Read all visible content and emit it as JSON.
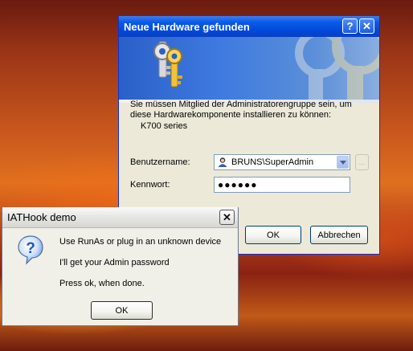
{
  "hardware_dialog": {
    "title": "Neue Hardware gefunden",
    "help_button": "?",
    "close_button": "✕",
    "message": "Sie müssen Mitglied der Administratorengruppe sein, um diese Hardwarekomponente installieren zu können:",
    "device": "K700 series",
    "username_label": "Benutzername:",
    "username_value": "BRUNS\\SuperAdmin",
    "browse_label": "...",
    "password_label": "Kennwort:",
    "password_value": "●●●●●●",
    "ok_button": "OK",
    "cancel_button": "Abbrechen"
  },
  "iathook_dialog": {
    "title": "IATHook demo",
    "close_button": "✕",
    "line1": "Use RunAs or plug in an unknown device",
    "line2": "I'll get your Admin password",
    "line3": "Press ok, when done.",
    "ok_button": "OK"
  },
  "colors": {
    "xp_title_blue": "#0a5ae8",
    "desktop_orange": "#d8641e"
  }
}
